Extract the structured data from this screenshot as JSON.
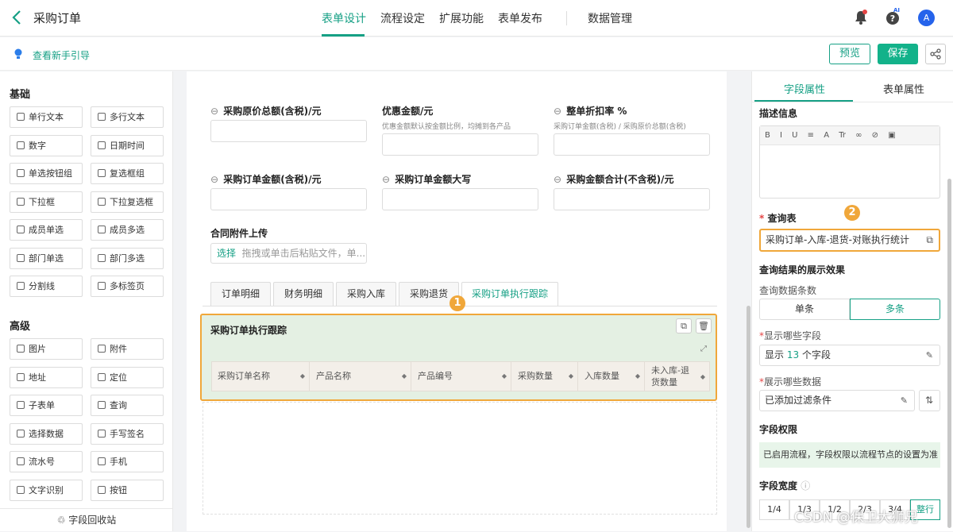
{
  "header": {
    "title": "采购订单",
    "nav": [
      "表单设计",
      "流程设定",
      "扩展功能",
      "表单发布",
      "数据管理"
    ],
    "avatar": "A",
    "ai_label": "AI"
  },
  "guide": {
    "text": "查看新手引导",
    "preview": "预览",
    "save": "保存"
  },
  "left": {
    "basic_title": "基础",
    "basic": [
      "单行文本",
      "多行文本",
      "数字",
      "日期时间",
      "单选按钮组",
      "复选框组",
      "下拉框",
      "下拉复选框",
      "成员单选",
      "成员多选",
      "部门单选",
      "部门多选",
      "分割线",
      "多标签页"
    ],
    "advanced_title": "高级",
    "advanced": [
      "图片",
      "附件",
      "地址",
      "定位",
      "子表单",
      "查询",
      "选择数据",
      "手写签名",
      "流水号",
      "手机",
      "文字识别",
      "按钮"
    ],
    "recycle": "字段回收站"
  },
  "form": {
    "f1": "采购原价总额(含税)/元",
    "f2": "优惠金额/元",
    "f2_hint": "优惠金额默认按金额比例，均摊到各产品",
    "f3": "整单折扣率 %",
    "f3_hint": "采购订单金额(含税) / 采购原价总额(含税)",
    "f4": "采购订单金额(含税)/元",
    "f5": "采购订单金额大写",
    "f6": "采购金额合计(不含税)/元",
    "attach_label": "合同附件上传",
    "attach_select": "选择",
    "attach_hint": "拖拽或单击后粘贴文件，单...",
    "tabs": [
      "订单明细",
      "财务明细",
      "采购入库",
      "采购退货",
      "采购订单执行跟踪"
    ],
    "sub_title": "采购订单执行跟踪",
    "columns": [
      "采购订单名称",
      "产品名称",
      "产品编号",
      "采购数量",
      "入库数量",
      "未入库-退货数量"
    ],
    "badge1": "1",
    "badge2": "2"
  },
  "right": {
    "tab_field": "字段属性",
    "tab_form": "表单属性",
    "desc_label": "描述信息",
    "toolbar": "B I U ≡ A Tr ∞ ⊘ ▣",
    "query_label": "查询表",
    "query_value": "采购订单-入库-退货-对账执行统计",
    "result_label": "查询结果的展示效果",
    "count_label": "查询数据条数",
    "single": "单条",
    "multi": "多条",
    "fields_label": "显示哪些字段",
    "fields_pre": "显示",
    "fields_num": "13",
    "fields_post": "个字段",
    "data_label": "展示哪些数据",
    "data_value": "已添加过滤条件",
    "perm_label": "字段权限",
    "perm_notice": "已启用流程，字段权限以流程节点的设置为准",
    "width_label": "字段宽度",
    "widths": [
      "1/4",
      "1/3",
      "1/2",
      "2/3",
      "3/4",
      "整行"
    ]
  },
  "watermark": "CSDN @保卫大狮兄",
  "colors": {
    "accent": "#16a085",
    "highlight": "#f0a73a"
  }
}
